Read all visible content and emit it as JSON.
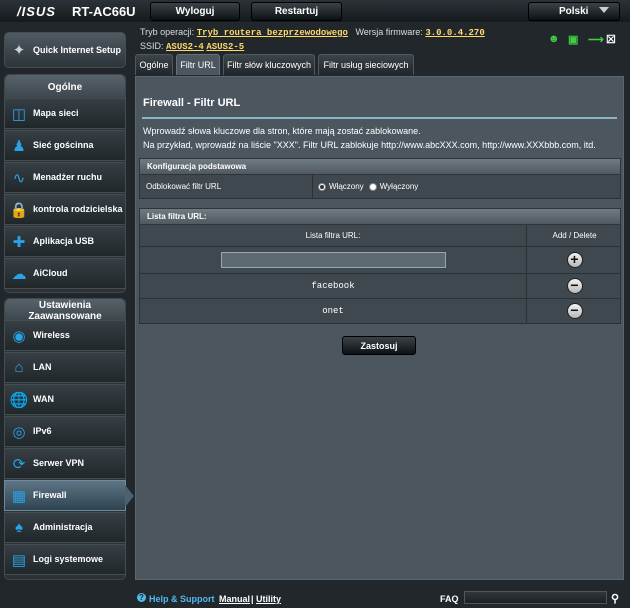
{
  "header": {
    "brand": "/ISUS",
    "model": "RT-AC66U",
    "logout": "Wyloguj",
    "restart": "Restartuj",
    "language": "Polski",
    "mode_label": "Tryb operacji:",
    "mode_value": "Tryb routera bezprzewodowego",
    "firmware_label": "Wersja firmware:",
    "firmware_value": "3.0.0.4.270",
    "ssid_label": "SSID:",
    "ssid_1": "ASUS2-4",
    "ssid_2": "ASUS2-5",
    "status_icons": [
      "user-icon",
      "network-icon",
      "usb-icon"
    ]
  },
  "sidebar": {
    "quick_setup": "Quick Internet Setup",
    "general_title": "Ogólne",
    "general_items": [
      {
        "label": "Mapa sieci",
        "icon": "network-map-icon"
      },
      {
        "label": "Sieć gościnna",
        "icon": "guest-network-icon"
      },
      {
        "label": "Menadżer ruchu",
        "icon": "traffic-manager-icon"
      },
      {
        "label": "kontrola rodzicielska",
        "icon": "parental-control-icon"
      },
      {
        "label": "Aplikacja USB",
        "icon": "usb-application-icon"
      },
      {
        "label": "AiCloud",
        "icon": "aicloud-icon"
      }
    ],
    "advanced_title": "Ustawienia Zaawansowane",
    "advanced_items": [
      {
        "label": "Wireless",
        "icon": "wireless-icon"
      },
      {
        "label": "LAN",
        "icon": "lan-icon"
      },
      {
        "label": "WAN",
        "icon": "wan-icon"
      },
      {
        "label": "IPv6",
        "icon": "ipv6-icon"
      },
      {
        "label": "Serwer VPN",
        "icon": "vpn-icon"
      },
      {
        "label": "Firewall",
        "icon": "firewall-icon"
      },
      {
        "label": "Administracja",
        "icon": "administration-icon"
      },
      {
        "label": "Logi systemowe",
        "icon": "system-log-icon"
      }
    ]
  },
  "tabs": [
    "Ogólne",
    "Filtr URL",
    "Filtr słów kluczowych",
    "Filtr usług sieciowych"
  ],
  "main": {
    "title": "Firewall - Filtr URL",
    "desc1": "Wprowadź słowa kluczowe dla stron, które mają zostać zablokowane.",
    "desc2": "Na przykład, wprowadź na liście \"XXX\". Filtr URL zablokuje http://www.abcXXX.com, http://www.XXXbbb.com, itd.",
    "basic_config_title": "Konfiguracja podstawowa",
    "enable_label": "Odblokować filtr URL",
    "radio_on": "Włączony",
    "radio_off": "Wyłączony",
    "list_title": "Lista filtra URL:",
    "col_list": "Lista filtra URL:",
    "col_action": "Add / Delete",
    "entry_placeholder": "",
    "entries": [
      "facebook",
      "onet"
    ],
    "apply": "Zastosuj"
  },
  "footer": {
    "help": "Help & Support",
    "manual": "Manual",
    "divider": "|",
    "utility": "Utility",
    "faq": "FAQ"
  }
}
